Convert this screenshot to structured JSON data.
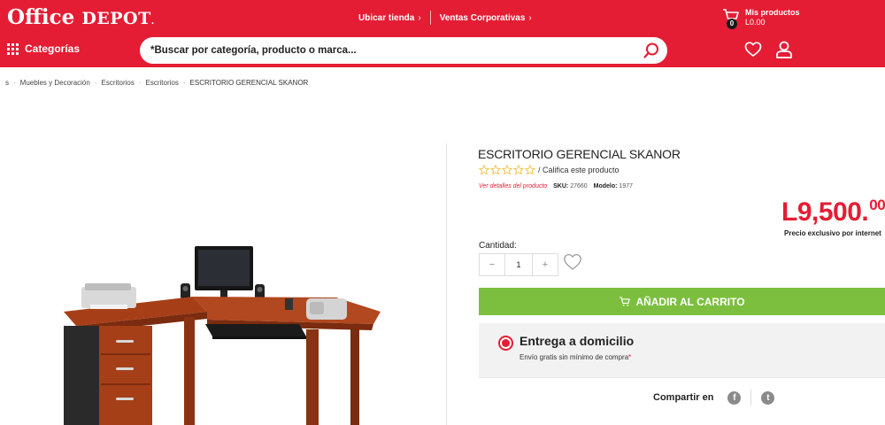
{
  "header": {
    "logo_word1": "Office",
    "logo_word2": "DEPOT",
    "links": [
      {
        "label": "Ubicar tienda",
        "arrow": "›"
      },
      {
        "label": "Ventas Corporativas",
        "arrow": "›"
      }
    ],
    "cart": {
      "title": "Mis productos",
      "amount": "L0.00",
      "count": "0"
    },
    "categories_label": "Categorías",
    "search_placeholder": "*Buscar por categoría, producto o marca..."
  },
  "breadcrumb": [
    "s",
    "Muebles y Decoración",
    "Escritorios",
    "Escritorios",
    "ESCRITORIO GERENCIAL SKANOR"
  ],
  "breadcrumb_separator": "·",
  "product": {
    "title": "ESCRITORIO GERENCIAL SKANOR",
    "rating_stars": 0,
    "rating_max": 5,
    "rate_text": "/ Califica este producto",
    "details_link": "Ver detalles del producto",
    "sku_label": "SKU:",
    "sku": "27660",
    "model_label": "Modelo:",
    "model": "1977",
    "price_main": "L9,500.",
    "price_cents": "00",
    "price_note": "Precio exclusivo por internet",
    "quantity_label": "Cantidad:",
    "quantity": "1",
    "minus": "−",
    "plus": "+",
    "add_to_cart": "AÑADIR AL CARRITO"
  },
  "delivery": {
    "title": "Entrega a domicilio",
    "subtitle": "Envío gratis sin mínimo de compra",
    "asterisk": "*"
  },
  "share": {
    "label": "Compartir en",
    "facebook": "f",
    "twitter": "t"
  },
  "colors": {
    "brand_red": "#e41d34",
    "cart_green": "#7cbf3f",
    "desk_wood": "#b2481f"
  },
  "icons": {
    "categories": "grid-icon",
    "search": "search-icon",
    "cart": "cart-icon",
    "wishlist": "heart-icon",
    "account": "user-icon",
    "facebook": "facebook-icon",
    "twitter": "twitter-icon"
  }
}
